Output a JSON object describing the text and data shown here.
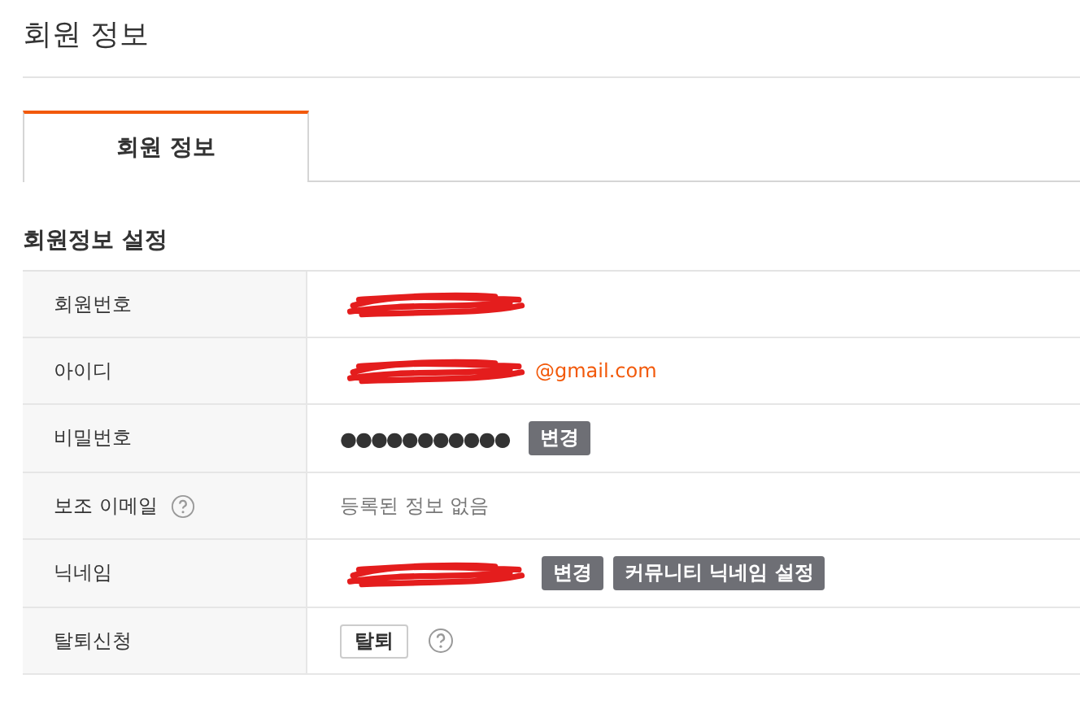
{
  "page_title": "회원 정보",
  "tabs": [
    {
      "label": "회원 정보",
      "selected": true
    }
  ],
  "section_title": "회원정보 설정",
  "rows": [
    {
      "label": "회원번호",
      "help": false,
      "redacted": true
    },
    {
      "label": "아이디",
      "help": false,
      "redacted": true,
      "value": "@gmail.com",
      "kind": "email"
    },
    {
      "label": "비밀번호",
      "help": false,
      "redacted": false,
      "value": "●●●●●●●●●●●",
      "kind": "password",
      "buttons": [
        {
          "label": "변경",
          "kind": "dark"
        }
      ]
    },
    {
      "label": "보조 이메일",
      "help": true,
      "redacted": false,
      "value": "등록된 정보 없음",
      "kind": "note"
    },
    {
      "label": "닉네임",
      "help": false,
      "redacted": true,
      "buttons": [
        {
          "label": "변경",
          "kind": "dark"
        },
        {
          "label": "커뮤니티 닉네임 설정",
          "kind": "dark"
        }
      ]
    },
    {
      "label": "탈퇴신청",
      "help": false,
      "redacted": false,
      "buttons": [
        {
          "label": "탈퇴",
          "kind": "outline"
        }
      ],
      "trailing_help": true
    }
  ]
}
